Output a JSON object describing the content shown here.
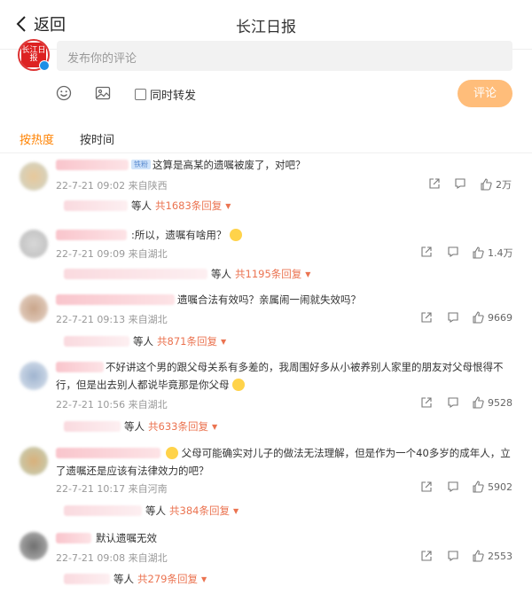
{
  "header": {
    "back_label": "返回",
    "title": "长江日报"
  },
  "composer": {
    "avatar_text": "长江日报",
    "placeholder": "发布你的评论",
    "repost_label": "同时转发",
    "submit_label": "评论"
  },
  "sort": {
    "hot": "按热度",
    "time": "按时间"
  },
  "comments": [
    {
      "badge": "铁粉",
      "text": "这算是高某的遗嘱被废了，对吧？",
      "meta": "22-7-21 09:02 来自陕西",
      "likes": "2万",
      "reply_suffix": "等人",
      "reply_count": "共1683条回复"
    },
    {
      "text": ":所以，遗嘱有啥用？",
      "meta": "22-7-21 09:09 来自湖北",
      "likes": "1.4万",
      "reply_suffix": "等人",
      "reply_count": "共1195条回复"
    },
    {
      "text": "遗嘱合法有效吗？亲属闹一闹就失效吗？",
      "meta": "22-7-21 09:13 来自湖北",
      "likes": "9669",
      "reply_suffix": "等人",
      "reply_count": "共871条回复"
    },
    {
      "text": "不好讲这个男的跟父母关系有多差的，我周围好多从小被养别人家里的朋友对父母恨得不行，但是出去别人都说毕竟那是你父母",
      "meta": "22-7-21 10:56 来自湖北",
      "likes": "9528",
      "reply_suffix": "等人",
      "reply_count": "共633条回复"
    },
    {
      "text": "父母可能确实对儿子的做法无法理解，但是作为一个40多岁的成年人，立了遗嘱还是应该有法律效力的吧？",
      "meta": "22-7-21 10:17 来自河南",
      "likes": "5902",
      "reply_suffix": "等人",
      "reply_count": "共384条回复"
    },
    {
      "text": "默认遗嘱无效",
      "meta": "22-7-21 09:08 来自湖北",
      "likes": "2553",
      "reply_suffix": "等人",
      "reply_count": "共279条回复"
    }
  ]
}
